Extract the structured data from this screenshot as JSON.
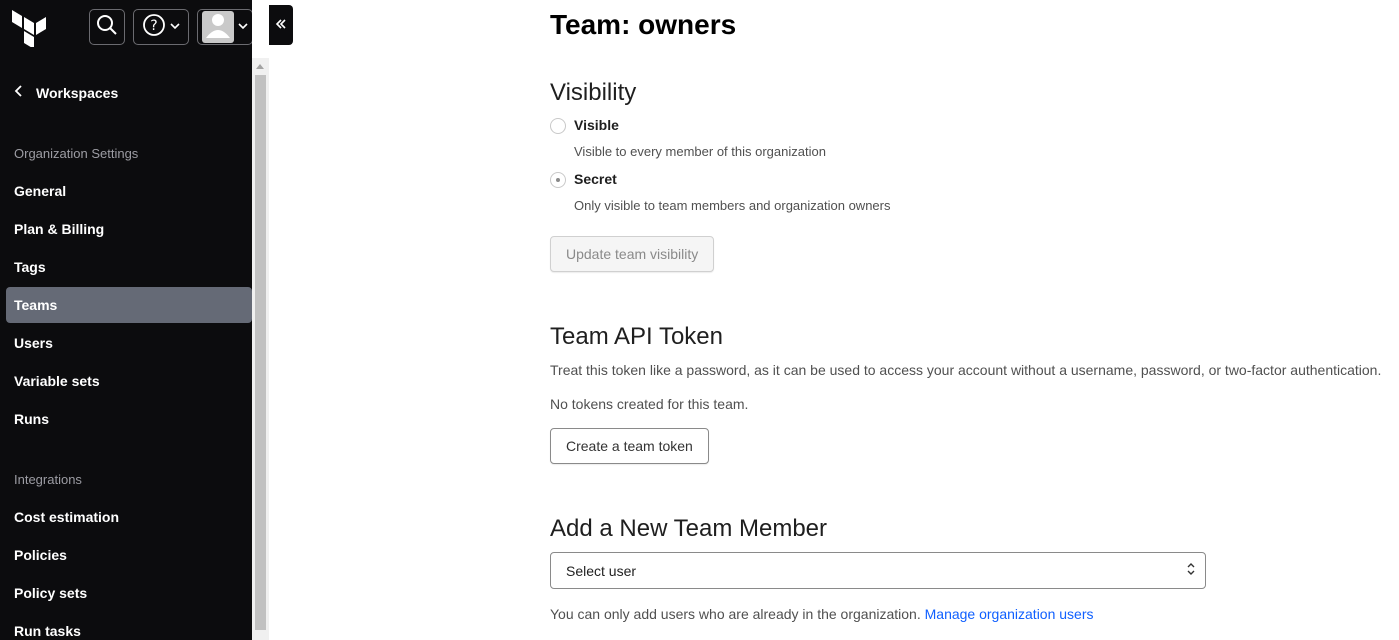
{
  "colors": {
    "sidebar_bg": "#0c0c0e",
    "active_nav_bg": "#656a76",
    "link": "#1060ff"
  },
  "topbar": {
    "logo": "terraform-logo",
    "search_icon": "search-icon",
    "help_icon": "help-circle-icon",
    "user_icon": "user-avatar-icon",
    "collapse_icon": "double-chevron-left-icon"
  },
  "sidebar": {
    "back_label": "Workspaces",
    "org_section_label": "Organization Settings",
    "org_items": [
      {
        "label": "General"
      },
      {
        "label": "Plan & Billing"
      },
      {
        "label": "Tags"
      },
      {
        "label": "Teams",
        "active": true
      },
      {
        "label": "Users"
      },
      {
        "label": "Variable sets"
      },
      {
        "label": "Runs"
      }
    ],
    "integrations_section_label": "Integrations",
    "integration_items": [
      {
        "label": "Cost estimation"
      },
      {
        "label": "Policies"
      },
      {
        "label": "Policy sets"
      },
      {
        "label": "Run tasks"
      }
    ]
  },
  "main": {
    "title": "Team: owners",
    "visibility": {
      "heading": "Visibility",
      "options": [
        {
          "label": "Visible",
          "description": "Visible to every member of this organization",
          "selected": false
        },
        {
          "label": "Secret",
          "description": "Only visible to team members and organization owners",
          "selected": true
        }
      ],
      "update_button": "Update team visibility"
    },
    "api_token": {
      "heading": "Team API Token",
      "description": "Treat this token like a password, as it can be used to access your account without a username, password, or two-factor authentication.",
      "empty_text": "No tokens created for this team.",
      "create_button": "Create a team token"
    },
    "add_member": {
      "heading": "Add a New Team Member",
      "select_value": "Select user",
      "help_text": "You can only add users who are already in the organization.",
      "help_link": "Manage organization users"
    }
  }
}
